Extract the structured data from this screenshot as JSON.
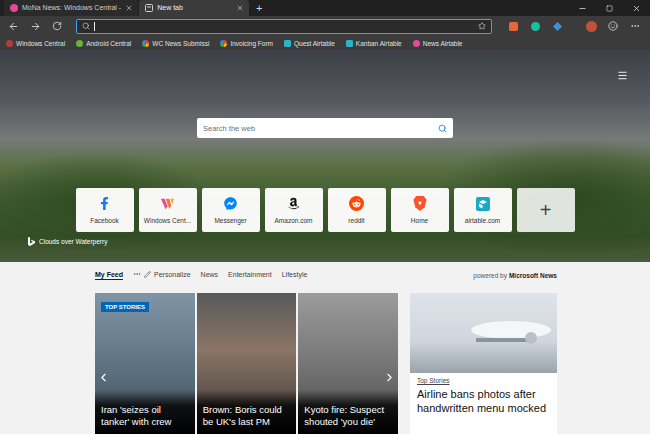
{
  "tabs": [
    {
      "label": "MoNa News: Windows Central -",
      "selected": false
    },
    {
      "label": "New tab",
      "selected": true
    }
  ],
  "new_tab_button": "+",
  "address_bar": {
    "focused": true
  },
  "favorites": [
    {
      "label": "Windows Central"
    },
    {
      "label": "Android Central"
    },
    {
      "label": "WC News Submissi"
    },
    {
      "label": "Invoicing Form"
    },
    {
      "label": "Quest Airtable"
    },
    {
      "label": "Kanban Airtable"
    },
    {
      "label": "News Airtable"
    }
  ],
  "hero": {
    "search": {
      "placeholder": "Search the web"
    },
    "tiles": [
      {
        "label": "Facebook"
      },
      {
        "label": "Windows Cent..."
      },
      {
        "label": "Messenger"
      },
      {
        "label": "Amazon.com"
      },
      {
        "label": "reddit"
      },
      {
        "label": "Home"
      },
      {
        "label": "airtable.com"
      }
    ],
    "add_tile": "+",
    "photo_caption": "Clouds over Waterperry"
  },
  "feed": {
    "nav": [
      {
        "label": "My Feed",
        "kind": "tab",
        "selected": true
      },
      {
        "label": "Personalize",
        "kind": "edit",
        "selected": false
      },
      {
        "label": "News",
        "kind": "tab",
        "selected": false
      },
      {
        "label": "Entertainment",
        "kind": "tab",
        "selected": false
      },
      {
        "label": "Lifestyle",
        "kind": "tab",
        "selected": false
      }
    ],
    "powered_by": "powered by",
    "powered_brand": "Microsoft News",
    "carousel": {
      "badge": "TOP STORIES",
      "stories": [
        {
          "headline": "Iran 'seizes oil tanker' with crew"
        },
        {
          "headline": "Brown: Boris could be UK's last PM"
        },
        {
          "headline": "Kyoto fire: Suspect shouted 'you die'"
        }
      ]
    },
    "side_story": {
      "label": "Top Stories",
      "headline": "Airline bans photos after handwritten menu mocked"
    }
  }
}
